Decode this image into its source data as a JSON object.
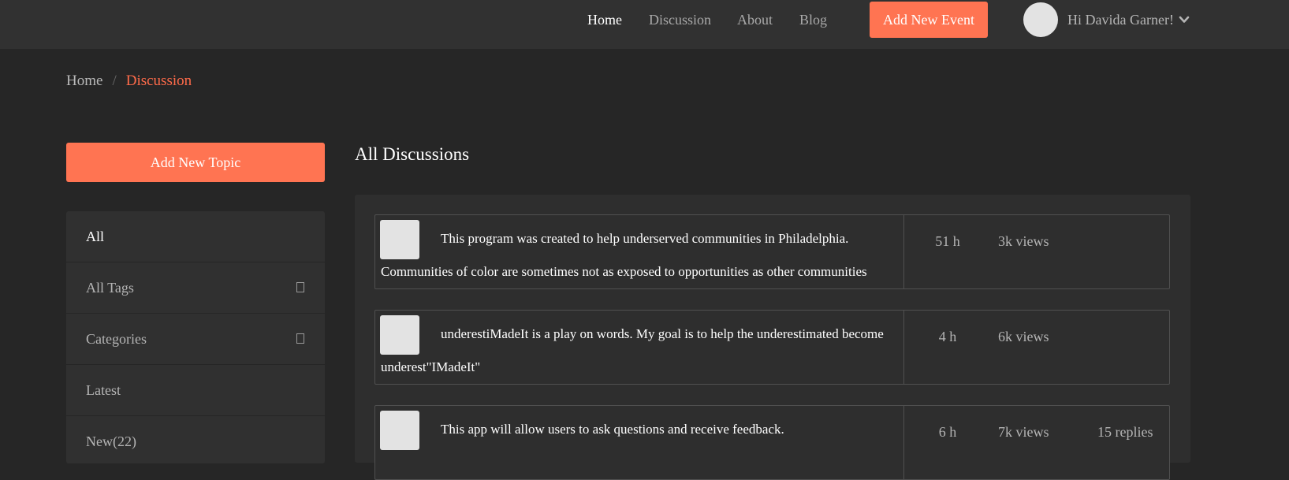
{
  "nav": {
    "links": [
      {
        "label": "Home",
        "active": true
      },
      {
        "label": "Discussion",
        "active": false
      },
      {
        "label": "About",
        "active": false
      },
      {
        "label": "Blog",
        "active": false
      }
    ],
    "add_event_label": "Add New Event",
    "greeting": "Hi Davida Garner!",
    "user_menu_icon": "chevron-down-icon"
  },
  "breadcrumb": {
    "home": "Home",
    "separator": "/",
    "current": "Discussion"
  },
  "sidebar": {
    "add_topic_label": "Add New Topic",
    "items": [
      {
        "label": "All",
        "active": true,
        "has_toggle": false
      },
      {
        "label": "All Tags",
        "active": false,
        "has_toggle": true
      },
      {
        "label": "Categories",
        "active": false,
        "has_toggle": true
      },
      {
        "label": "Latest",
        "active": false,
        "has_toggle": false
      },
      {
        "label": "New(22)",
        "active": false,
        "has_toggle": false
      }
    ]
  },
  "main": {
    "title": "All Discussions",
    "topics": [
      {
        "text": "This program was created to help underserved communities in Philadelphia. Communities of color are sometimes not as exposed to opportunities as other communities",
        "time": "51 h",
        "views": "3k views",
        "replies": ""
      },
      {
        "text": "underestiMadeIt is a play on words. My goal is to help the underestimated become underest\"IMadeIt\"",
        "time": "4 h",
        "views": "6k views",
        "replies": ""
      },
      {
        "text": "This app will allow users to ask questions and receive feedback.",
        "time": "6 h",
        "views": "7k views",
        "replies": "15 replies"
      }
    ]
  },
  "colors": {
    "accent": "#ff7452",
    "background": "#262626",
    "topbar": "#313131",
    "panel": "#2e2e2e"
  }
}
